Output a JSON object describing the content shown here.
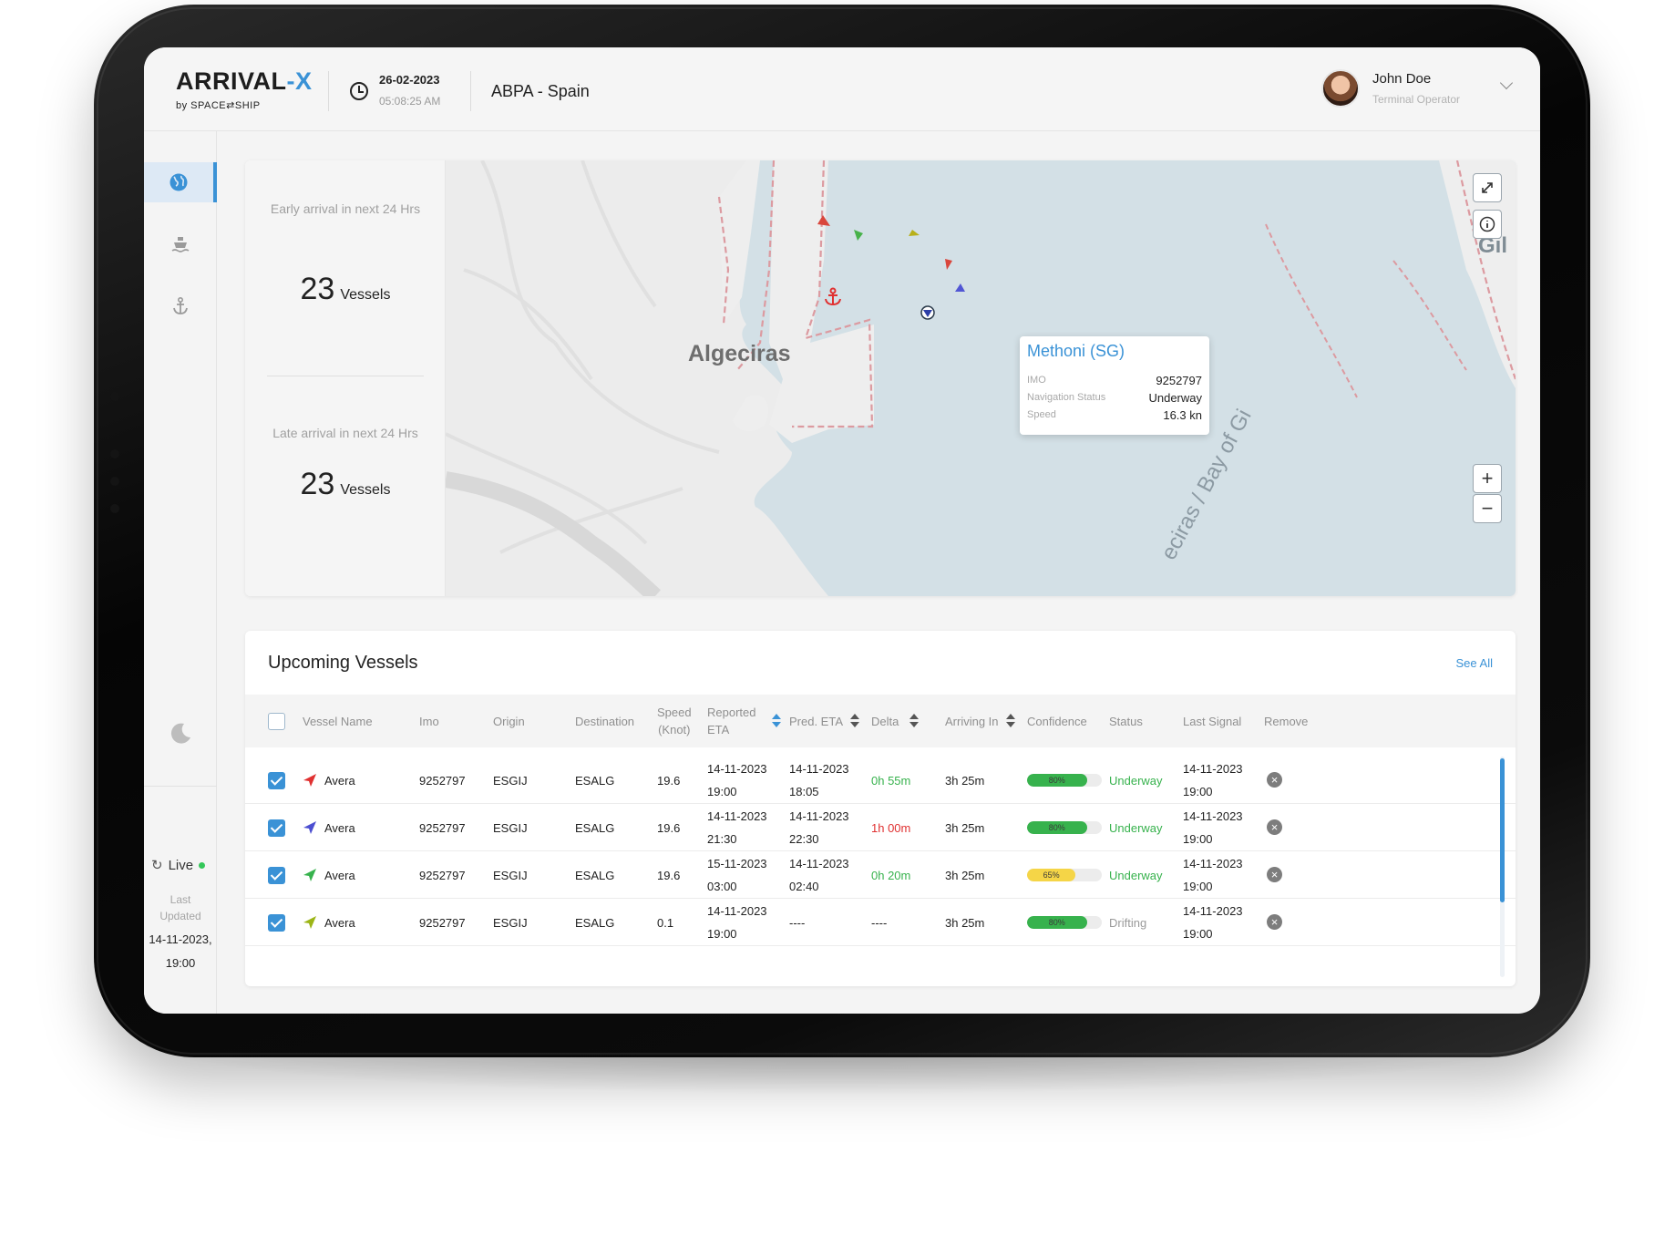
{
  "colors": {
    "accent": "#3a92d6",
    "positive": "#37b24d",
    "negative": "#e03131",
    "live": "#34c759"
  },
  "header": {
    "logo": "ARRIVAL",
    "logo_dash": "-X",
    "logo_sub": "by SPACE⇄SHIP",
    "date": "26-02-2023",
    "time": "05:08:25 AM",
    "port": "ABPA  -  Spain",
    "user_name": "John Doe",
    "user_role": "Terminal Operator"
  },
  "sidebar": {
    "items": [
      {
        "icon": "globe-icon",
        "active": true
      },
      {
        "icon": "ship-icon",
        "active": false
      },
      {
        "icon": "anchor-icon",
        "active": false
      }
    ],
    "theme_icon": "moon-icon",
    "live_label": "Live",
    "last_updated_label": "Last Updated",
    "last_updated_value": "14-11-2023, 19:00"
  },
  "stats": {
    "early_label": "Early arrival in next 24 Hrs",
    "early_count": "23",
    "early_unit": "Vessels",
    "late_label": "Late arrival in next 24 Hrs",
    "late_count": "23",
    "late_unit": "Vessels"
  },
  "map": {
    "city_label": "Algeciras",
    "bay_label": "eciras / Bay of Gi",
    "edge_label": "Gil",
    "tooltip": {
      "title": "Methoni (SG)",
      "rows": [
        {
          "key": "IMO",
          "value": "9252797"
        },
        {
          "key": "Navigation Status",
          "value": "Underway"
        },
        {
          "key": "Speed",
          "value": "16.3 kn"
        }
      ]
    }
  },
  "table": {
    "title": "Upcoming Vessels",
    "see_all": "See All",
    "headers": {
      "vessel": "Vessel Name",
      "imo": "Imo",
      "origin": "Origin",
      "destination": "Destination",
      "speed_1": "Speed",
      "speed_2": "(Knot)",
      "reported_1": "Reported",
      "reported_2": "ETA",
      "pred": "Pred. ETA",
      "delta": "Delta",
      "arriving": "Arriving In",
      "confidence": "Confidence",
      "status": "Status",
      "last_signal": "Last Signal",
      "remove": "Remove"
    },
    "rows": [
      {
        "flag_color": "#e03131",
        "name": "Avera",
        "imo": "9252797",
        "origin": "ESGIJ",
        "destination": "ESALG",
        "speed": "19.6",
        "rep_date": "14-11-2023",
        "rep_time": "19:00",
        "pred_date": "14-11-2023",
        "pred_time": "18:05",
        "delta": "0h 55m",
        "delta_color": "#37b24d",
        "arriving": "3h 25m",
        "confidence": 80,
        "confidence_label": "80%",
        "confidence_color": "#37b24d",
        "status": "Underway",
        "status_color": "#37b24d",
        "ls_date": "14-11-2023",
        "ls_time": "19:00"
      },
      {
        "flag_color": "#4c4fd1",
        "name": "Avera",
        "imo": "9252797",
        "origin": "ESGIJ",
        "destination": "ESALG",
        "speed": "19.6",
        "rep_date": "14-11-2023",
        "rep_time": "21:30",
        "pred_date": "14-11-2023",
        "pred_time": "22:30",
        "delta": "1h 00m",
        "delta_color": "#e03131",
        "arriving": "3h 25m",
        "confidence": 80,
        "confidence_label": "80%",
        "confidence_color": "#37b24d",
        "status": "Underway",
        "status_color": "#37b24d",
        "ls_date": "14-11-2023",
        "ls_time": "19:00"
      },
      {
        "flag_color": "#37b24d",
        "name": "Avera",
        "imo": "9252797",
        "origin": "ESGIJ",
        "destination": "ESALG",
        "speed": "19.6",
        "rep_date": "15-11-2023",
        "rep_time": "03:00",
        "pred_date": "14-11-2023",
        "pred_time": "02:40",
        "delta": "0h 20m",
        "delta_color": "#37b24d",
        "arriving": "3h 25m",
        "confidence": 65,
        "confidence_label": "65%",
        "confidence_color": "#f5d547",
        "status": "Underway",
        "status_color": "#37b24d",
        "ls_date": "14-11-2023",
        "ls_time": "19:00"
      },
      {
        "flag_color": "#9cb516",
        "name": "Avera",
        "imo": "9252797",
        "origin": "ESGIJ",
        "destination": "ESALG",
        "speed": "0.1",
        "rep_date": "14-11-2023",
        "rep_time": "19:00",
        "pred_date": "----",
        "pred_time": "",
        "delta": "----",
        "delta_color": "#222222",
        "arriving": "3h 25m",
        "confidence": 80,
        "confidence_label": "80%",
        "confidence_color": "#37b24d",
        "status": "Drifting",
        "status_color": "#9a9a9a",
        "ls_date": "14-11-2023",
        "ls_time": "19:00"
      }
    ]
  }
}
